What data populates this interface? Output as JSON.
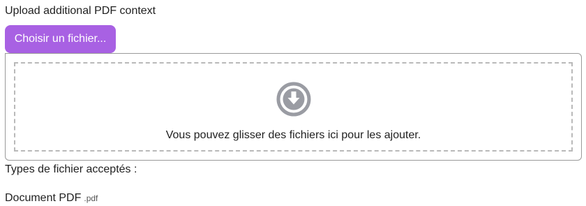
{
  "upload": {
    "label": "Upload additional PDF context",
    "choose_button_label": "Choisir un fichier...",
    "dropzone_text": "Vous pouvez glisser des fichiers ici pour les ajouter.",
    "dropzone_icon": "download-circle-icon",
    "accepted_types_label": "Types de fichier acceptés :",
    "accepted_types": [
      {
        "name": "Document PDF",
        "extension": ".pdf"
      }
    ]
  },
  "colors": {
    "button_bg": "#a861e3",
    "icon": "#9a9ca3",
    "dashed_border": "#b9b9b9"
  }
}
